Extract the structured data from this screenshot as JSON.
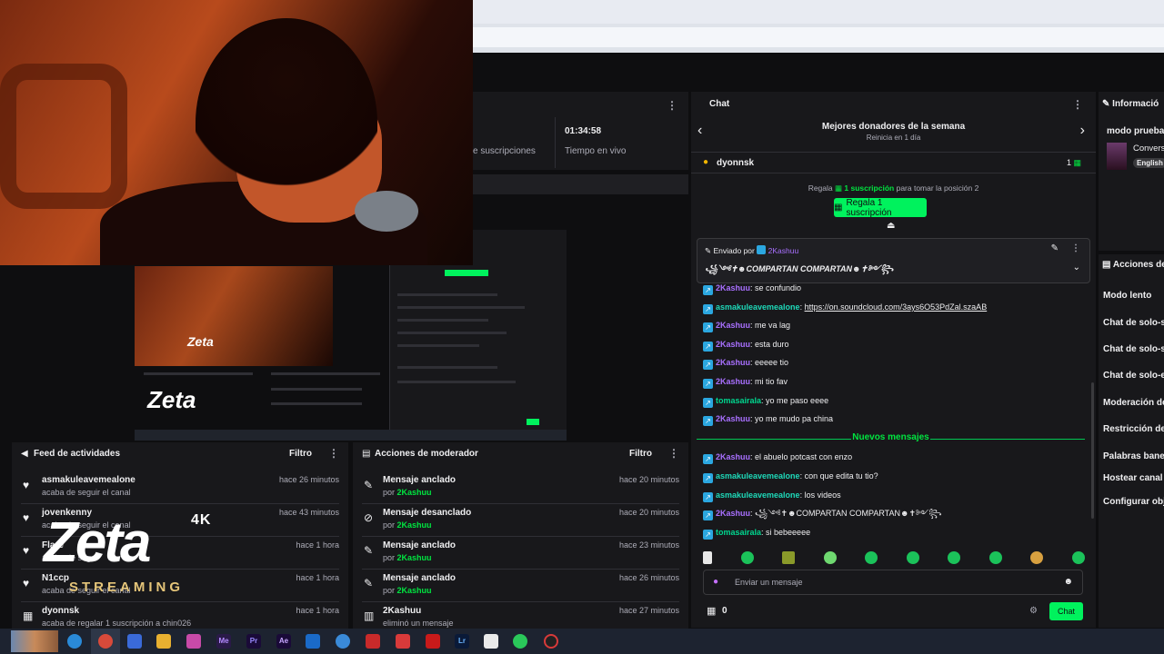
{
  "stats": {
    "subs_label": "e suscripciones",
    "live_time": "01:34:58",
    "live_label": "Tiempo en vivo"
  },
  "feed": {
    "title": "Feed de actividades",
    "filter": "Filtro",
    "items": [
      {
        "name": "asmakuleavemealone",
        "sub": "acaba de seguir el canal",
        "time": "hace 26 minutos",
        "icon": "heart-icon"
      },
      {
        "name": "jovenkenny",
        "sub": "acaba de seguir el canal",
        "time": "hace 43 minutos",
        "icon": "heart-icon"
      },
      {
        "name": "Flare",
        "sub": "acaba de seg",
        "time": "hace 1 hora",
        "icon": "heart-icon"
      },
      {
        "name": "N1ccp",
        "sub": "acaba de seguir el canal",
        "time": "hace 1 hora",
        "icon": "heart-icon"
      },
      {
        "name": "dyonnsk",
        "sub": "acaba de regalar 1 suscripción a chin026",
        "time": "hace 1 hora",
        "icon": "gift-icon"
      }
    ]
  },
  "logo": {
    "k4": "4K",
    "zeta": "Zeta",
    "streaming": "STREAMING"
  },
  "mod": {
    "title": "Acciones de moderador",
    "filter": "Filtro",
    "items": [
      {
        "action": "Mensaje anclado",
        "by": "por ",
        "user": "2Kashuu",
        "time": "hace 20 minutos",
        "icon": "pin-icon"
      },
      {
        "action": "Mensaje desanclado",
        "by": "por ",
        "user": "2Kashuu",
        "time": "hace 20 minutos",
        "icon": "unpin-icon"
      },
      {
        "action": "Mensaje anclado",
        "by": "por ",
        "user": "2Kashuu",
        "time": "hace 23 minutos",
        "icon": "pin-icon"
      },
      {
        "action": "Mensaje anclado",
        "by": "por ",
        "user": "2Kashuu",
        "time": "hace 26 minutos",
        "icon": "pin-icon"
      },
      {
        "action": "2Kashuu",
        "by": "eliminó un mensaje",
        "user": "",
        "time": "hace 27 minutos",
        "icon": "trash-icon"
      }
    ]
  },
  "chat": {
    "title": "Chat",
    "donors_title": "Mejores donadores de la semana",
    "donors_reset": "Reinicia en 1 día",
    "top_donor": "dyonnsk",
    "top_donor_count": "1",
    "gift_text_pre": "Regala",
    "gift_text_sub": "1 suscripción",
    "gift_text_post": "para tomar la posición 2",
    "gift_button": "Regala 1 suscripción",
    "pinned_by": "Enviado por",
    "pinned_user": "2Kashuu",
    "pinned_msg": "꧁༺✝☻COMPARTAN COMPARTAN☻✝༻꧂",
    "messages": [
      {
        "user": "2Kashuu",
        "cls": "u1",
        "text": ": se confundio"
      },
      {
        "user": "asmakuleavemealone",
        "cls": "u2",
        "text": ": ",
        "link": "https://on.soundcloud.com/3ays6O53PdZal.szaAB"
      },
      {
        "user": "2Kashuu",
        "cls": "u1",
        "text": ": me va lag"
      },
      {
        "user": "2Kashuu",
        "cls": "u1",
        "text": ": esta duro"
      },
      {
        "user": "2Kashuu",
        "cls": "u1",
        "text": ": eeeee tio"
      },
      {
        "user": "2Kashuu",
        "cls": "u1",
        "text": ": mi tio fav"
      },
      {
        "user": "tomasairala",
        "cls": "u3",
        "text": ": yo me paso eeee"
      },
      {
        "user": "2Kashuu",
        "cls": "u1",
        "text": ": yo me mudo pa china"
      }
    ],
    "new_label": "Nuevos mensajes",
    "new_messages": [
      {
        "user": "2Kashuu",
        "cls": "u1",
        "text": ": el abuelo potcast con enzo"
      },
      {
        "user": "asmakuleavemealone",
        "cls": "u2",
        "text": ": con que edita tu tio?"
      },
      {
        "user": "asmakuleavemealone",
        "cls": "u2",
        "text": ": los videos"
      },
      {
        "user": "2Kashuu",
        "cls": "u1",
        "text": ": ꧁༺✝☻COMPARTAN COMPARTAN☻✝༻꧂"
      },
      {
        "user": "tomasairala",
        "cls": "u3",
        "text": ": si bebeeeee"
      }
    ],
    "input_placeholder": "Enviar un mensaje",
    "points": "0",
    "send_label": "Chat"
  },
  "info": {
    "title": "Informació",
    "mode": "modo prueba",
    "category": "Convers",
    "tag": "English"
  },
  "mod_actions": {
    "title": "Acciones de",
    "items": [
      "Modo lento",
      "Chat de solo-s",
      "Chat de solo-s",
      "Chat de solo-e",
      "Moderación de",
      "Restricción de",
      "Palabras banea",
      "Hostear canal",
      "Configurar obj"
    ]
  },
  "colors": {
    "accent": "#00f25d",
    "brand_purple": "#a970ff",
    "bg": "#0e0e10",
    "panel": "#18181b"
  }
}
